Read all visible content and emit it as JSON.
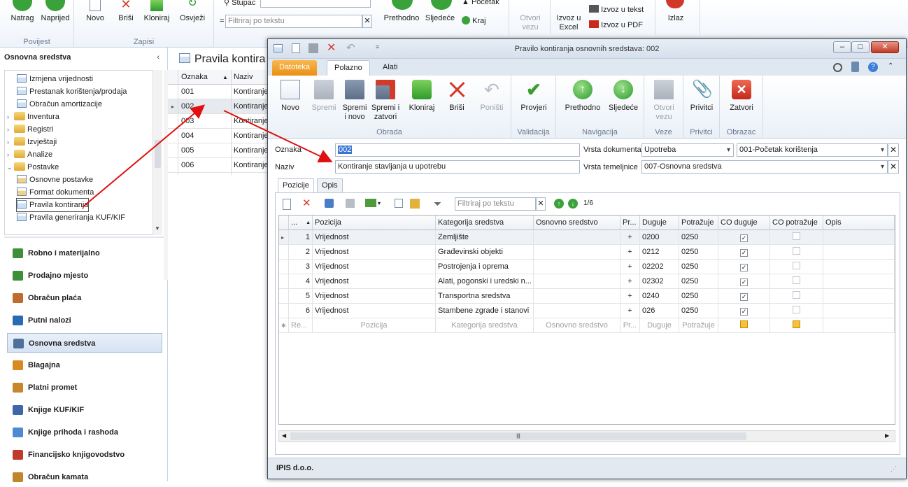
{
  "main_ribbon": {
    "groups": [
      {
        "caption": "Povijest",
        "buttons": [
          "Natrag",
          "Naprijed"
        ]
      },
      {
        "caption": "Zapisi",
        "buttons": [
          "Novo",
          "Briši",
          "Kloniraj",
          "Osvježi"
        ]
      }
    ],
    "column_label": "Stupac",
    "filter_placeholder": "Filtriraj po tekstu",
    "prev_label": "Prethodno",
    "next_label": "Sljedeće",
    "start_label": "Početak",
    "end_label": "Kraj",
    "open_link_label": "Otvori vezu",
    "export_excel_label": "Izvoz u Excel",
    "export_text_label": "Izvoz u tekst",
    "export_pdf_label": "Izvoz u PDF",
    "exit_label": "Izlaz"
  },
  "left_panel": {
    "title": "Osnovna sredstva",
    "tree": [
      {
        "label": "Izmjena vrijednosti",
        "type": "form",
        "level": 1
      },
      {
        "label": "Prestanak korištenja/prodaja",
        "type": "form",
        "level": 1
      },
      {
        "label": "Obračun amortizacije",
        "type": "form",
        "level": 1
      },
      {
        "label": "Inventura",
        "type": "folder",
        "level": 0
      },
      {
        "label": "Registri",
        "type": "folder",
        "level": 0
      },
      {
        "label": "Izvještaji",
        "type": "folder",
        "level": 0
      },
      {
        "label": "Analize",
        "type": "folder",
        "level": 0
      },
      {
        "label": "Postavke",
        "type": "folder-open",
        "level": 0
      },
      {
        "label": "Osnovne postavke",
        "type": "settings",
        "level": 1
      },
      {
        "label": "Format dokumenta",
        "type": "settings",
        "level": 1
      },
      {
        "label": "Pravila kontiranja",
        "type": "form",
        "level": 1,
        "selected": true
      },
      {
        "label": "Pravila generiranja KUF/KIF",
        "type": "form",
        "level": 1
      }
    ],
    "modules": [
      "Robno i materijalno",
      "Prodajno mjesto",
      "Obračun plaća",
      "Putni nalozi",
      "Osnovna sredstva",
      "Blagajna",
      "Platni promet",
      "Knjige KUF/KIF",
      "Knjige prihoda i rashoda",
      "Financijsko knjigovodstvo",
      "Obračun kamata"
    ],
    "active_module": "Osnovna sredstva"
  },
  "list": {
    "title": "Pravila kontira",
    "col_code": "Oznaka",
    "col_name": "Naziv",
    "rows": [
      {
        "code": "001",
        "name": "Kontiranje"
      },
      {
        "code": "002",
        "name": "Kontiranje"
      },
      {
        "code": "003",
        "name": "Kontiranje"
      },
      {
        "code": "004",
        "name": "Kontiranje"
      },
      {
        "code": "005",
        "name": "Kontiranje"
      },
      {
        "code": "006",
        "name": "Kontiranje"
      }
    ]
  },
  "dialog": {
    "title": "Pravilo kontiranja osnovnih sredstava: 002",
    "tabs": [
      "Datoteka",
      "Polazno",
      "Alati"
    ],
    "ribbon": {
      "new": "Novo",
      "save": "Spremi",
      "save_new_1": "Spremi",
      "save_new_2": "i novo",
      "save_close_1": "Spremi i",
      "save_close_2": "zatvori",
      "clone": "Kloniraj",
      "delete": "Briši",
      "undo": "Poništi",
      "group_obrada": "Obrada",
      "check": "Provjeri",
      "group_validacija": "Validacija",
      "prev": "Prethodno",
      "next": "Sljedeće",
      "group_navigacija": "Navigacija",
      "open_link_1": "Otvori",
      "open_link_2": "vezu",
      "group_veze": "Veze",
      "attach": "Privitci",
      "group_privitci": "Privitci",
      "close": "Zatvori",
      "group_obrazac": "Obrazac"
    },
    "form": {
      "code_label": "Oznaka",
      "code_value": "002",
      "name_label": "Naziv",
      "name_value": "Kontiranje stavljanja u upotrebu",
      "doc_type_label": "Vrsta dokumenta",
      "doc_type_value": "Upotreba",
      "doc_type_sub": "001-Početak korištenja",
      "basis_label": "Vrsta temeljnice",
      "basis_value": "007-Osnovna sredstva"
    },
    "inner_tabs": [
      "Pozicije",
      "Opis"
    ],
    "grid_filter_placeholder": "Filtriraj po tekstu",
    "page_counter": "1/6",
    "grid": {
      "headers": [
        "...",
        "Pozicija",
        "Kategorija sredstva",
        "Osnovno sredstvo",
        "Pr...",
        "Duguje",
        "Potražuje",
        "CO duguje",
        "CO potražuje",
        "Opis"
      ],
      "rows": [
        {
          "n": "1",
          "pos": "Vrijednost",
          "cat": "Zemljište",
          "asset": "",
          "sign": "+",
          "debit": "0200",
          "credit": "0250",
          "co_d": true,
          "co_c": false
        },
        {
          "n": "2",
          "pos": "Vrijednost",
          "cat": "Građevinski objekti",
          "asset": "",
          "sign": "+",
          "debit": "0212",
          "credit": "0250",
          "co_d": true,
          "co_c": false
        },
        {
          "n": "3",
          "pos": "Vrijednost",
          "cat": "Postrojenja i oprema",
          "asset": "",
          "sign": "+",
          "debit": "02202",
          "credit": "0250",
          "co_d": true,
          "co_c": false
        },
        {
          "n": "4",
          "pos": "Vrijednost",
          "cat": "Alati, pogonski i uredski n...",
          "asset": "",
          "sign": "+",
          "debit": "02302",
          "credit": "0250",
          "co_d": true,
          "co_c": false
        },
        {
          "n": "5",
          "pos": "Vrijednost",
          "cat": "Transportna sredstva",
          "asset": "",
          "sign": "+",
          "debit": "0240",
          "credit": "0250",
          "co_d": true,
          "co_c": false
        },
        {
          "n": "6",
          "pos": "Vrijednost",
          "cat": "Stambene zgrade i stanovi",
          "asset": "",
          "sign": "+",
          "debit": "026",
          "credit": "0250",
          "co_d": true,
          "co_c": false
        }
      ],
      "new_row": [
        "Re...",
        "Pozicija",
        "Kategorija sredstva",
        "Osnovno sredstvo",
        "Pr...",
        "Duguje",
        "Potražuje"
      ]
    },
    "status_text": "IPIS d.o.o."
  }
}
